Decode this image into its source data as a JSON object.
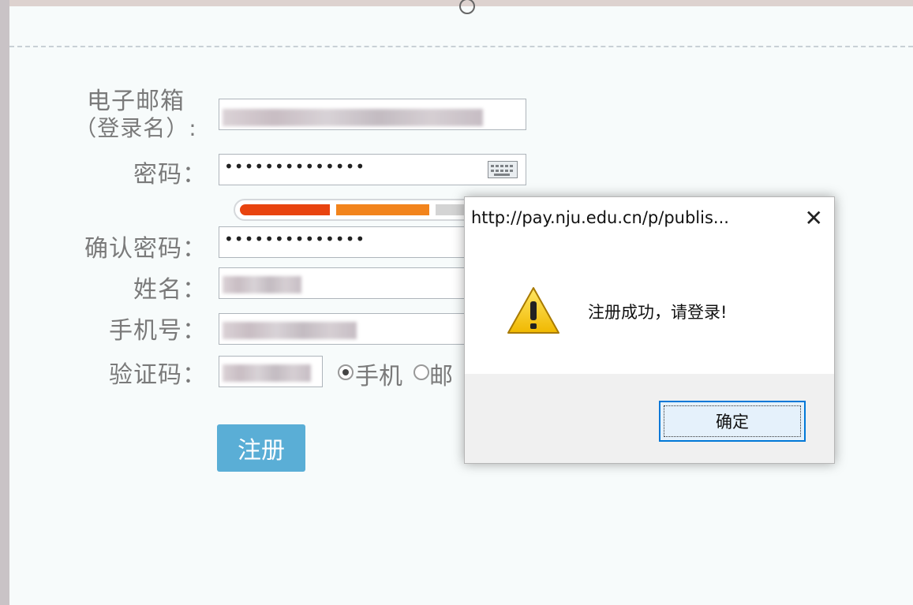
{
  "form": {
    "email_label_line1": "电子邮箱",
    "email_label_line2": "（登录名）:",
    "password_label": "密码：",
    "password_value": "••••••••••••••",
    "confirm_label": "确认密码：",
    "confirm_value": "••••••••••••••",
    "name_label": "姓名：",
    "phone_label": "手机号：",
    "code_label": "验证码：",
    "radio_phone": "手机",
    "radio_email": "邮",
    "register_button": "注册",
    "strength_colors": [
      "#e8430f",
      "#f2841c",
      "#d4d4d4"
    ]
  },
  "dialog": {
    "title": "http://pay.nju.edu.cn/p/publis...",
    "close_icon": "close-icon",
    "message": "注册成功，请登录!",
    "ok_button": "确定",
    "icon": "warning-icon"
  }
}
